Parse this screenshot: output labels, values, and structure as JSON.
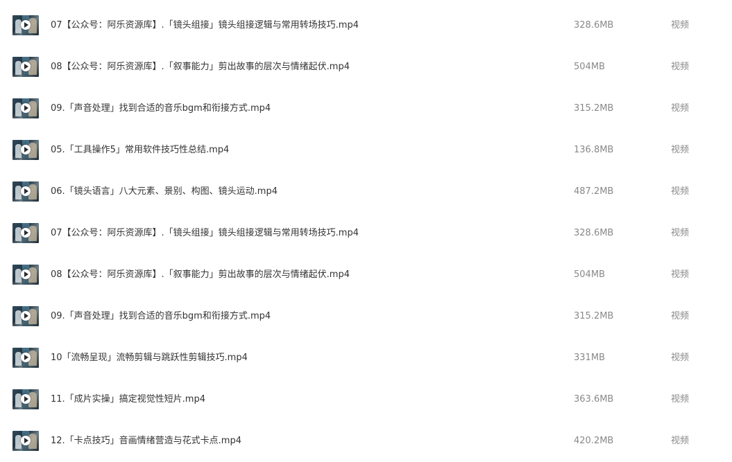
{
  "files": [
    {
      "name": "07【公众号：阿乐资源库】.「镜头组接」镜头组接逻辑与常用转场技巧.mp4",
      "size": "328.6MB",
      "type": "视频"
    },
    {
      "name": "08【公众号：阿乐资源库】.「叙事能力」剪出故事的层次与情绪起伏.mp4",
      "size": "504MB",
      "type": "视频"
    },
    {
      "name": "09.「声音处理」找到合适的音乐bgm和衔接方式.mp4",
      "size": "315.2MB",
      "type": "视频"
    },
    {
      "name": "05.「工具操作5」常用软件技巧性总结.mp4",
      "size": "136.8MB",
      "type": "视频"
    },
    {
      "name": "06.「镜头语言」八大元素、景别、构图、镜头运动.mp4",
      "size": "487.2MB",
      "type": "视频"
    },
    {
      "name": "07【公众号：阿乐资源库】.「镜头组接」镜头组接逻辑与常用转场技巧.mp4",
      "size": "328.6MB",
      "type": "视频"
    },
    {
      "name": "08【公众号：阿乐资源库】.「叙事能力」剪出故事的层次与情绪起伏.mp4",
      "size": "504MB",
      "type": "视频"
    },
    {
      "name": "09.「声音处理」找到合适的音乐bgm和衔接方式.mp4",
      "size": "315.2MB",
      "type": "视频"
    },
    {
      "name": "10「流畅呈现」流畅剪辑与跳跃性剪辑技巧.mp4",
      "size": "331MB",
      "type": "视频"
    },
    {
      "name": "11.「成片实操」搞定视觉性短片.mp4",
      "size": "363.6MB",
      "type": "视频"
    },
    {
      "name": "12.「卡点技巧」音画情绪营造与花式卡点.mp4",
      "size": "420.2MB",
      "type": "视频"
    }
  ],
  "icons": {
    "thumbnail": "video-thumbnail-icon",
    "play": "play-icon"
  }
}
